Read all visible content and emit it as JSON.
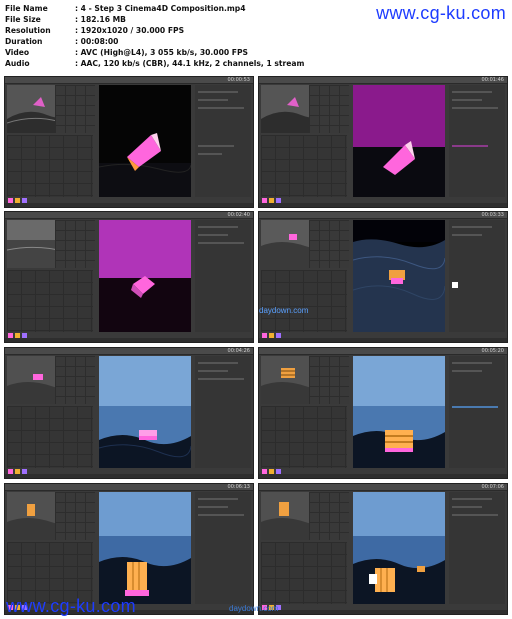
{
  "file_info": [
    {
      "key": "File Name",
      "value": ":  4 - Step 3 Cinema4D Composition.mp4"
    },
    {
      "key": "File Size",
      "value": ":  182.16 MB"
    },
    {
      "key": "Resolution",
      "value": ":  1920x1020 / 30.000 FPS"
    },
    {
      "key": "Duration",
      "value": ":  00:08:00"
    },
    {
      "key": "Video",
      "value": ":  AVC (High@L4), 3 055 kb/s, 30.000 FPS"
    },
    {
      "key": "Audio",
      "value": ":  AAC, 120 kb/s (CBR), 44.1 kHz, 2 channels, 1 stream"
    }
  ],
  "watermarks": {
    "top": "www.cg-ku.com",
    "bottom": "www.cg-ku.com",
    "daydown": "daydown.com"
  },
  "thumbnails": [
    {
      "timecode": "00:00:53",
      "scene": "gem-dark"
    },
    {
      "timecode": "00:01:46",
      "scene": "gem-purple-sky"
    },
    {
      "timecode": "00:02:40",
      "scene": "cube-purple"
    },
    {
      "timecode": "00:03:33",
      "scene": "crate-ocean-dark"
    },
    {
      "timecode": "00:04:26",
      "scene": "crate-blue-sky"
    },
    {
      "timecode": "00:05:20",
      "scene": "crate-blue-sky-large"
    },
    {
      "timecode": "00:06:13",
      "scene": "crate-blue-sky-front"
    },
    {
      "timecode": "00:07:06",
      "scene": "crate-blue-sky-far"
    }
  ],
  "colors": {
    "brand_blue": "#1e3cff",
    "ui_dark": "#3a3a3a",
    "accent_pink": "#ff66dd"
  }
}
